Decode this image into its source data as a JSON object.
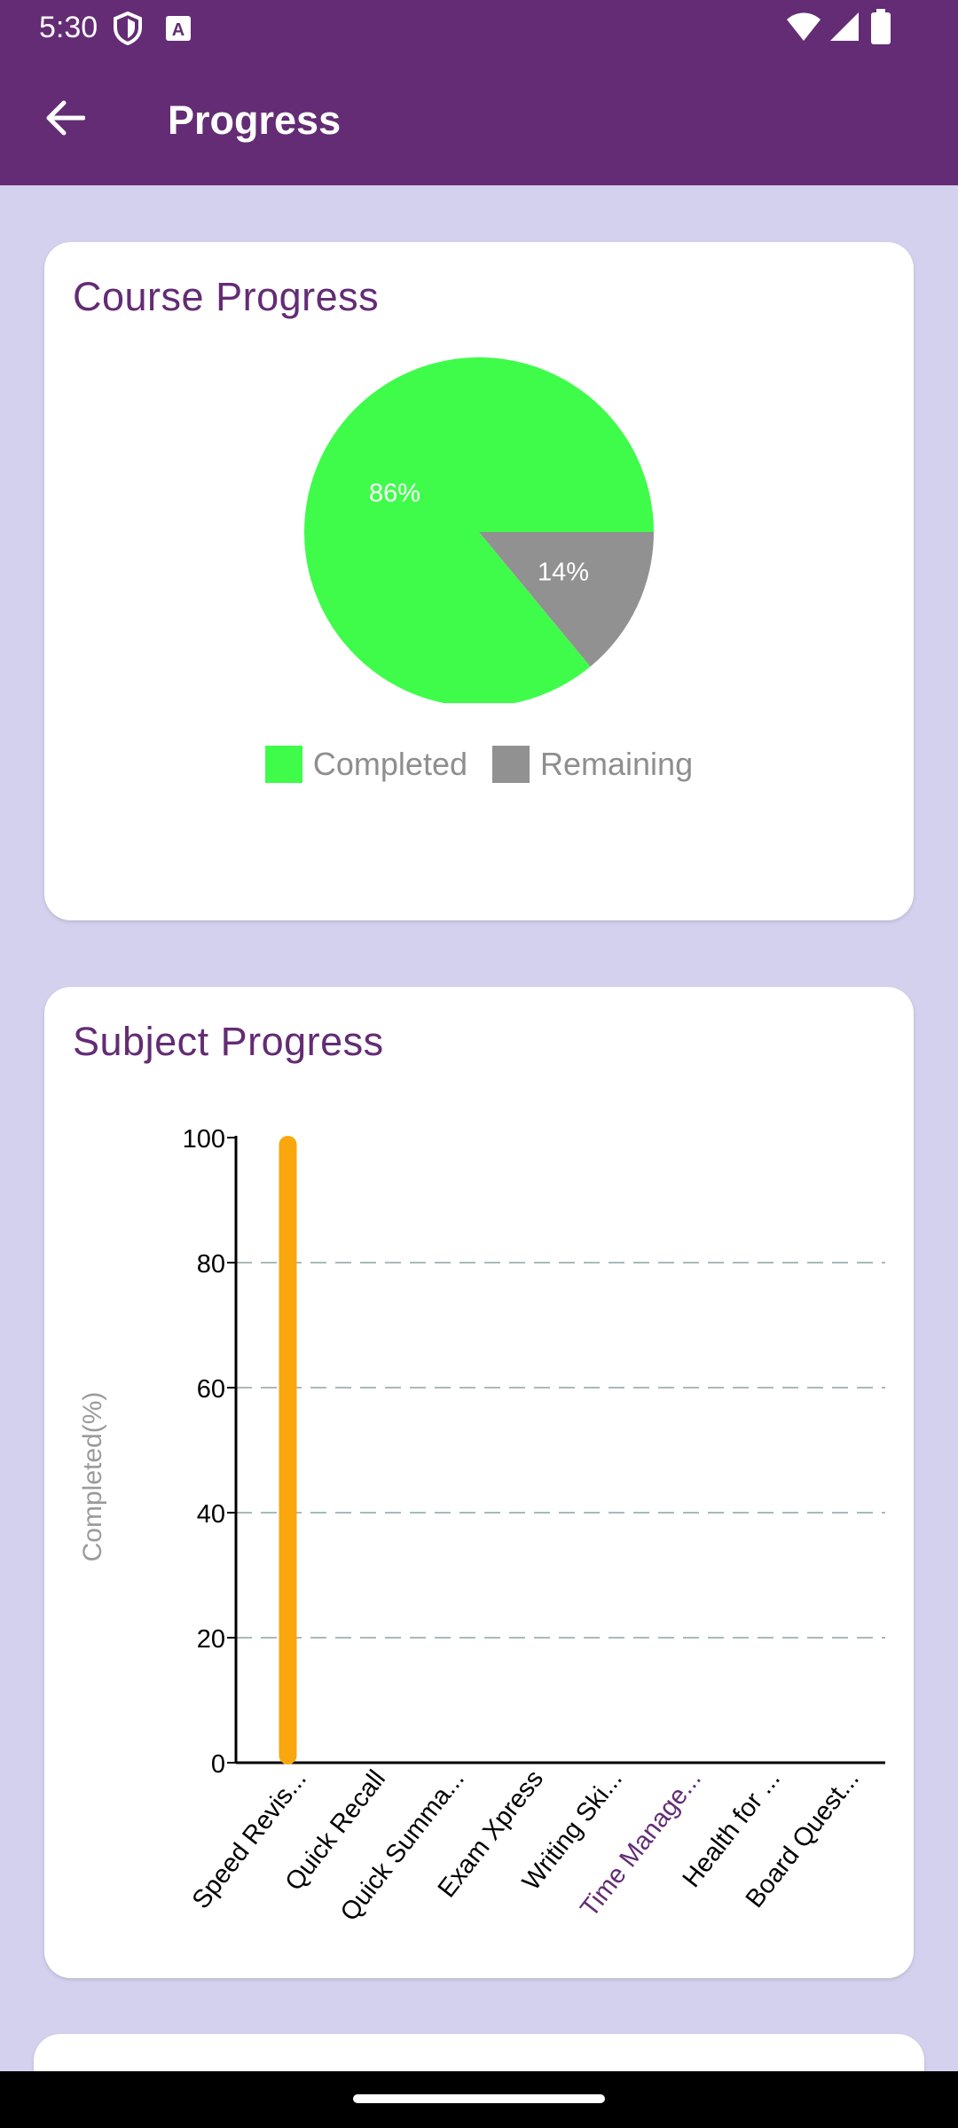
{
  "status_bar": {
    "time": "5:30",
    "icons": [
      "shield-icon",
      "text-a-icon",
      "wifi-icon",
      "cellular-icon",
      "battery-icon"
    ]
  },
  "app_bar": {
    "title": "Progress",
    "back_icon": "arrow-back-icon",
    "background": "#632c74"
  },
  "course_card": {
    "title": "Course Progress",
    "chart_data": {
      "type": "pie",
      "slices": [
        {
          "label": "Completed",
          "value": 86,
          "display": "86%",
          "color": "#3ffc4a"
        },
        {
          "label": "Remaining",
          "value": 14,
          "display": "14%",
          "color": "#919191"
        }
      ],
      "legend": [
        "Completed",
        "Remaining"
      ],
      "legend_position": "bottom"
    }
  },
  "subject_card": {
    "title": "Subject Progress",
    "chart_data": {
      "type": "bar",
      "ylabel": "Completed(%)",
      "ylim": [
        0,
        100
      ],
      "yticks": [
        0,
        20,
        40,
        60,
        80,
        100
      ],
      "grid": "horizontal dashed",
      "categories": [
        "Speed Revis...",
        "Quick Recall",
        "Quick Summa...",
        "Exam Xpress",
        "Writing Ski...",
        "Time Manage...",
        "Health for ...",
        "Board Quest..."
      ],
      "values": [
        100,
        0,
        0,
        0,
        0,
        0,
        0,
        0
      ],
      "bar_color": "#f9a70d",
      "highlighted_category_color": "#632c74"
    }
  }
}
